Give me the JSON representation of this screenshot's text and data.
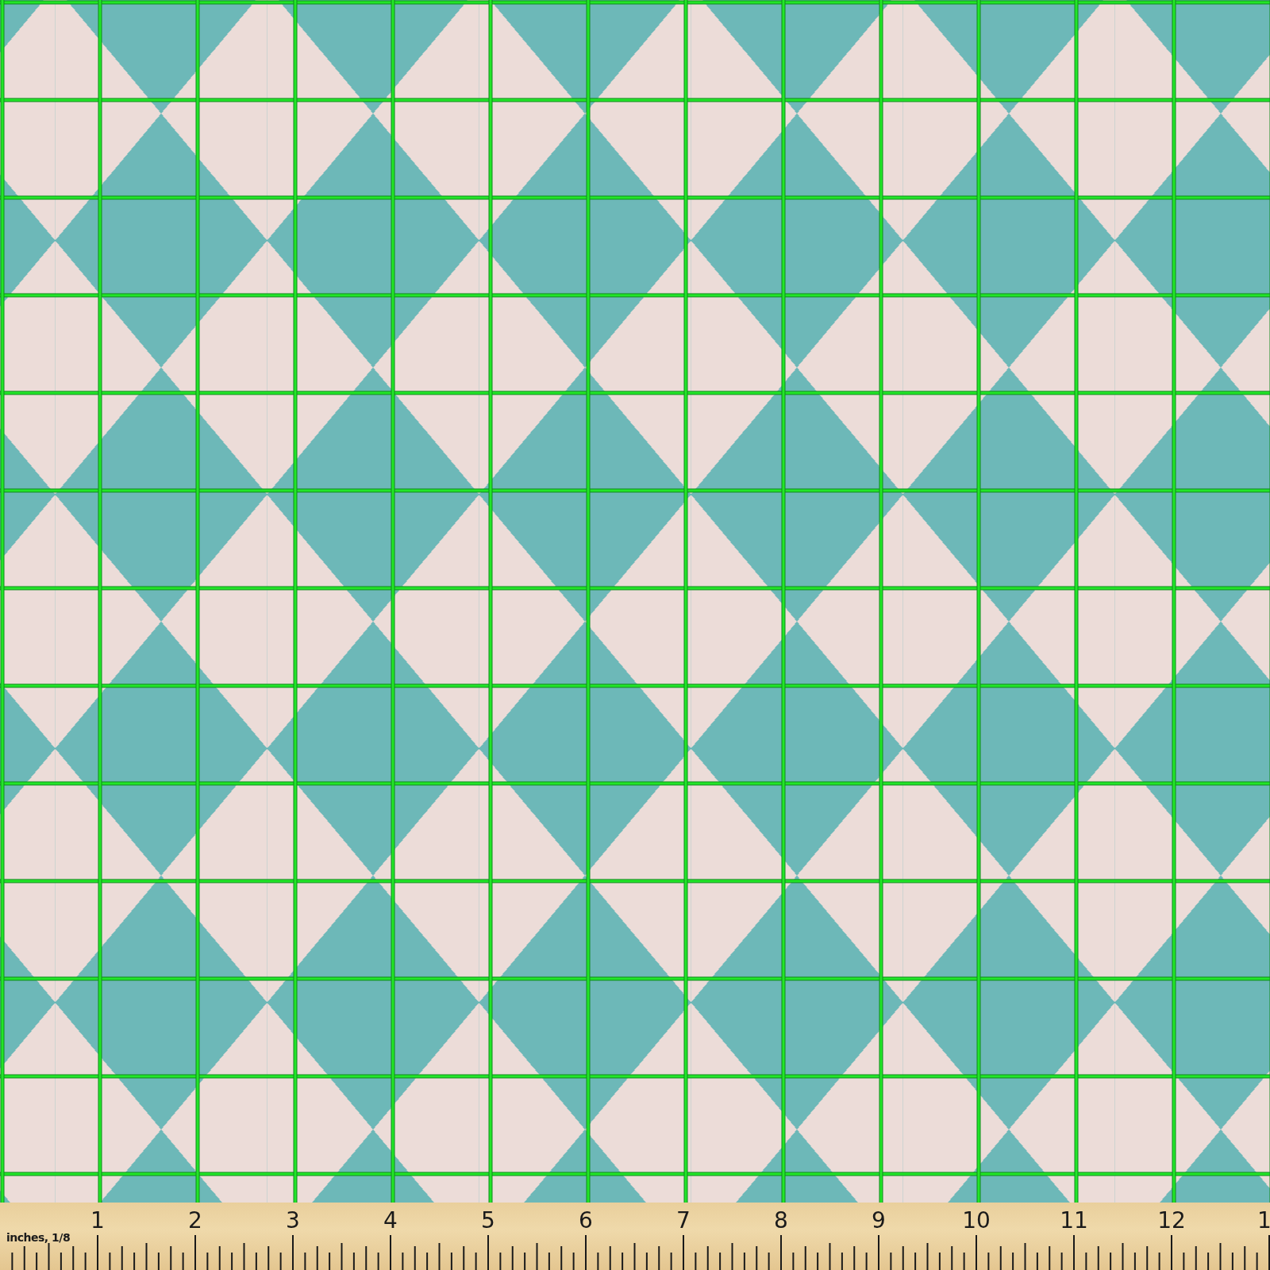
{
  "ruler": {
    "unit_label": "inches, 1/8",
    "numbers": [
      "1",
      "2",
      "3",
      "4",
      "5",
      "6",
      "7",
      "8",
      "9",
      "10",
      "11",
      "12",
      "1"
    ]
  }
}
